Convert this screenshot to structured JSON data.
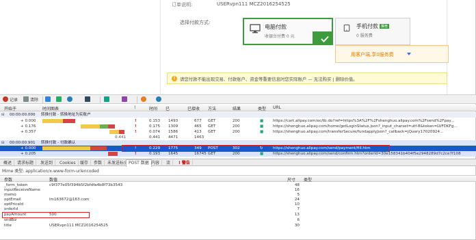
{
  "payment": {
    "order_label": "订单说明:",
    "order_value": "USERvpn111 MCZ2016254525",
    "method_label": "选择付款方式:",
    "pc_title": "电脑付款",
    "pc_sub": "收银台付费 0 元",
    "mobile_title": "手机付款",
    "mobile_badge": "推荐",
    "mobile_sub": "0 服务费",
    "promo_text": "用客户端,享0服务费",
    "notice": "请您付款不能出现交易、付款账户、资金等重要信息时您实际账户 — 无法购买 | 删除价值。"
  },
  "toolbar": {
    "items": [
      "记录",
      "清除",
      "",
      "",
      "",
      "",
      "",
      ""
    ],
    "colors": [
      "#c0392b",
      "#7f8c8d",
      "#2e86de",
      "#27ae60",
      "#2980b9",
      "#34495e",
      "#16a085",
      "#8e44ad",
      "#e67e22"
    ]
  },
  "network": {
    "columns": [
      "开始于",
      "时间图表",
      "",
      "!",
      "时间",
      "已",
      "已接收",
      "方法",
      "结果",
      "类型",
      "URL"
    ],
    "group1": {
      "start": "00:00:00.000",
      "label": "转换付款 - 转换地址为实账户"
    },
    "rows1": [
      {
        "start": "+ 0.000",
        "time": "0.153",
        "sent": "1493",
        "recv": "677",
        "method": "GET",
        "result": "200",
        "url": "https://cart.alipay.com/ec/tb.do?ref=https%3A%2F%2Fshenghuo.alipay.com%2Fsend%2Fpay..."
      },
      {
        "start": "+ 0.176",
        "time": "0.175",
        "sent": "1309",
        "recv": "465",
        "method": "GET",
        "result": "200",
        "url": "https://shenghuo.alipay.com/home/getLoginStatus.json?_input_charset=utf-8&token=LVFDKFg..."
      },
      {
        "start": "+ 0.357",
        "time": "0.074",
        "sent": "1586",
        "recv": "413",
        "method": "GET",
        "result": "200",
        "url": "https://shenghuo.alipay.com/transferSecure/fundapplyJson?_callback=jQuery17020924..."
      },
      {
        "start": "",
        "time": "0.441",
        "sent": "4471",
        "recv": "1463",
        "method": "",
        "result": "",
        "url": ""
      }
    ],
    "rows1_extra": "0.441",
    "group2": {
      "start": "00:00:00.901",
      "label": "转换付款 - 付款确认"
    },
    "rows2": [
      {
        "start": "+ 0.000",
        "time": "0.229",
        "sent": "1775",
        "recv": "349",
        "method": "POST",
        "result": "302",
        "url": "https://shenghuo.alipay.com/send/payment/fill.htm"
      },
      {
        "start": "+ 0.205",
        "time": "0.193",
        "sent": "1645",
        "recv": "16745",
        "method": "GET",
        "result": "200",
        "url": "https://shenghuo.alipay.com/send/confirm.htm?orderId=30e158341b404f5e2948289d7c2ce7f108"
      }
    ]
  },
  "detail": {
    "tabs": [
      "概述",
      "请求标题",
      "发送到",
      "Cookies",
      "缓存",
      "参数",
      "未发送标头",
      "POST 数据",
      "内容",
      "流",
      "! 警告"
    ],
    "mime": "Mime 类型: application/x-www-form-urlencoded",
    "params_header": [
      "参数",
      "数值",
      "尺寸",
      "类型"
    ],
    "params": [
      {
        "name": "_form_token",
        "value": "c9f377e05f394b5f2bfdfa4b8f73b3543",
        "size": "48",
        "type": ""
      },
      {
        "name": "inputReceiveName",
        "value": "",
        "size": "16",
        "type": ""
      },
      {
        "name": "memo",
        "value": "",
        "size": "5",
        "type": ""
      },
      {
        "name": "optEmail",
        "value": "lm163672@163.com",
        "size": "24",
        "type": ""
      },
      {
        "name": "optPriceId",
        "value": "",
        "size": "10",
        "type": ""
      },
      {
        "name": "orderId",
        "value": "",
        "size": "7",
        "type": ""
      },
      {
        "name": "payAmount",
        "value": "500",
        "size": "13",
        "type": ""
      },
      {
        "name": "sndBiz",
        "value": "",
        "size": "6",
        "type": ""
      },
      {
        "name": "title",
        "value": "USERvpn111 MCZ2016254525",
        "size": "30",
        "type": ""
      }
    ]
  }
}
